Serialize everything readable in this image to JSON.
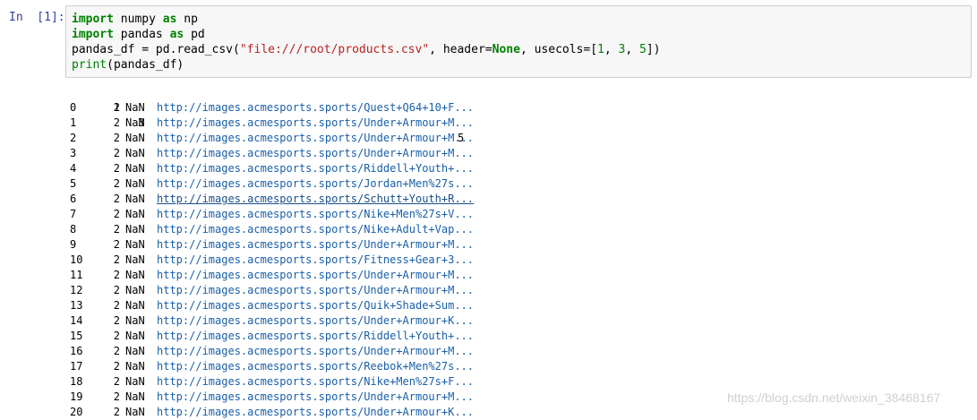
{
  "cell": {
    "prompt": "In  [1]:",
    "code": [
      [
        "import",
        " numpy ",
        "as",
        " np"
      ],
      [
        "import",
        " pandas ",
        "as",
        " pd"
      ],
      [
        "pandas_df = pd.read_csv(",
        "\"file:///root/products.csv\"",
        ", header=",
        "None",
        ", usecols=[",
        "1",
        ", ",
        "3",
        ", ",
        "5",
        "])"
      ],
      [
        "print",
        "(pandas_df)"
      ]
    ]
  },
  "output": {
    "header": {
      "col1": "1",
      "col3": "3",
      "col5": "5"
    },
    "rows": [
      {
        "idx": "0",
        "c1": "2",
        "c3": "NaN",
        "c5": "http://images.acmesports.sports/Quest+Q64+10+F..."
      },
      {
        "idx": "1",
        "c1": "2",
        "c3": "NaN",
        "c5": "http://images.acmesports.sports/Under+Armour+M..."
      },
      {
        "idx": "2",
        "c1": "2",
        "c3": "NaN",
        "c5": "http://images.acmesports.sports/Under+Armour+M..."
      },
      {
        "idx": "3",
        "c1": "2",
        "c3": "NaN",
        "c5": "http://images.acmesports.sports/Under+Armour+M..."
      },
      {
        "idx": "4",
        "c1": "2",
        "c3": "NaN",
        "c5": "http://images.acmesports.sports/Riddell+Youth+..."
      },
      {
        "idx": "5",
        "c1": "2",
        "c3": "NaN",
        "c5": "http://images.acmesports.sports/Jordan+Men%27s..."
      },
      {
        "idx": "6",
        "c1": "2",
        "c3": "NaN",
        "c5": "http://images.acmesports.sports/Schutt+Youth+R..."
      },
      {
        "idx": "7",
        "c1": "2",
        "c3": "NaN",
        "c5": "http://images.acmesports.sports/Nike+Men%27s+V..."
      },
      {
        "idx": "8",
        "c1": "2",
        "c3": "NaN",
        "c5": "http://images.acmesports.sports/Nike+Adult+Vap..."
      },
      {
        "idx": "9",
        "c1": "2",
        "c3": "NaN",
        "c5": "http://images.acmesports.sports/Under+Armour+M..."
      },
      {
        "idx": "10",
        "c1": "2",
        "c3": "NaN",
        "c5": "http://images.acmesports.sports/Fitness+Gear+3..."
      },
      {
        "idx": "11",
        "c1": "2",
        "c3": "NaN",
        "c5": "http://images.acmesports.sports/Under+Armour+M..."
      },
      {
        "idx": "12",
        "c1": "2",
        "c3": "NaN",
        "c5": "http://images.acmesports.sports/Under+Armour+M..."
      },
      {
        "idx": "13",
        "c1": "2",
        "c3": "NaN",
        "c5": "http://images.acmesports.sports/Quik+Shade+Sum..."
      },
      {
        "idx": "14",
        "c1": "2",
        "c3": "NaN",
        "c5": "http://images.acmesports.sports/Under+Armour+K..."
      },
      {
        "idx": "15",
        "c1": "2",
        "c3": "NaN",
        "c5": "http://images.acmesports.sports/Riddell+Youth+..."
      },
      {
        "idx": "16",
        "c1": "2",
        "c3": "NaN",
        "c5": "http://images.acmesports.sports/Under+Armour+M..."
      },
      {
        "idx": "17",
        "c1": "2",
        "c3": "NaN",
        "c5": "http://images.acmesports.sports/Reebok+Men%27s..."
      },
      {
        "idx": "18",
        "c1": "2",
        "c3": "NaN",
        "c5": "http://images.acmesports.sports/Nike+Men%27s+F..."
      },
      {
        "idx": "19",
        "c1": "2",
        "c3": "NaN",
        "c5": "http://images.acmesports.sports/Under+Armour+M..."
      },
      {
        "idx": "20",
        "c1": "2",
        "c3": "NaN",
        "c5": "http://images.acmesports.sports/Under+Armour+K..."
      }
    ],
    "hovered_row": "6"
  },
  "watermark": "https://blog.csdn.net/weixin_38468167",
  "colors": {
    "prompt": "#303f9f",
    "keyword": "#008000",
    "string": "#ba2121",
    "link": "#1a5fa8",
    "input_bg": "#f7f7f7"
  }
}
